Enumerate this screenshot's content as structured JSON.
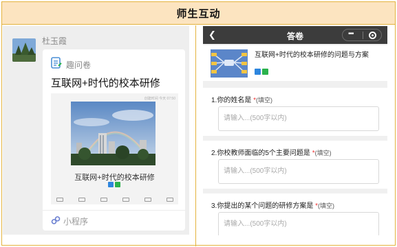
{
  "header": {
    "title": "师生互动"
  },
  "chat": {
    "sender": "杜玉霞",
    "card": {
      "type_label": "趣问卷",
      "title": "互联网+时代的校本研修",
      "preview_time": "创建时间 今天 07:50",
      "preview_title": "互联网+时代的校本研修",
      "footer_label": "小程序"
    }
  },
  "phone": {
    "nav": {
      "back_icon": "back-chevron-icon",
      "title": "答卷"
    },
    "survey": {
      "title": "互联网+时代的校本研修的问题与方案"
    },
    "questions": [
      {
        "number": "1.",
        "text": "你的姓名是",
        "required_mark": "*",
        "kind": "(填空)",
        "placeholder": "请输入...(500字以内)"
      },
      {
        "number": "2.",
        "text": "你校教师面临的5个主要问题是",
        "required_mark": "*",
        "kind": "(填空)",
        "placeholder": "请输入...(500字以内)"
      },
      {
        "number": "3.",
        "text": "你提出的某个问题的研修方案是",
        "required_mark": "*",
        "kind": "(填空)",
        "placeholder": "请输入...(500字以内)"
      }
    ]
  },
  "colors": {
    "header_bg": "#fce4c0",
    "border": "#e3b23c",
    "nav_bg": "#3c3c3c",
    "required": "#ee3333",
    "badge_blue": "#2e86de",
    "badge_green": "#2bb24c"
  }
}
